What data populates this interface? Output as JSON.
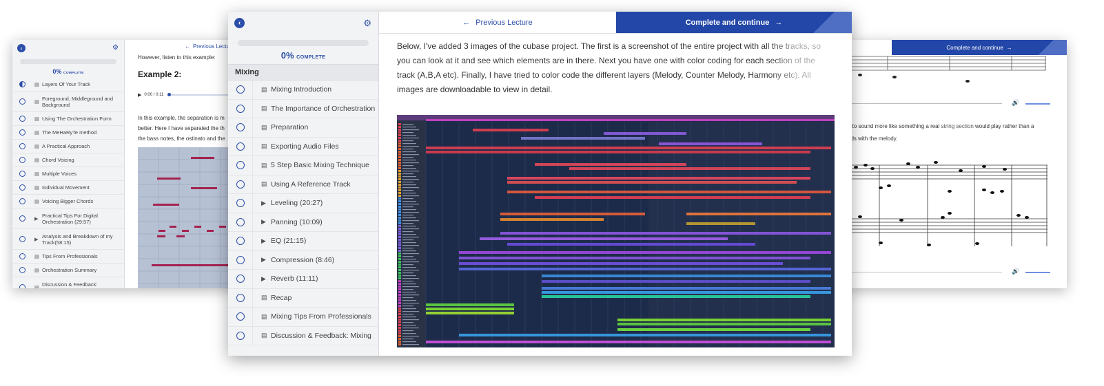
{
  "left_screen": {
    "complete_pct": "0%",
    "complete_word": "COMPLETE",
    "prev_label": "Previous Lecture",
    "intro_text": "However, listen to this example:",
    "heading": "Example 2:",
    "audio_time": "0:00 / 0:11",
    "paragraph_lines": [
      "In this example, the separation is m",
      "better. Here I have separated the th",
      "the bass notes, the ostinato and the"
    ],
    "items": [
      {
        "label": "Layers Of Your Track",
        "icon": "doc-icon",
        "state": "half"
      },
      {
        "label": "Foreground, Middleground and Background",
        "icon": "doc-icon"
      },
      {
        "label": "Using The Orchestration Form",
        "icon": "doc-icon"
      },
      {
        "label": "The MeHaRyTe method",
        "icon": "doc-icon"
      },
      {
        "label": "A Practical Approach",
        "icon": "doc-icon"
      },
      {
        "label": "Chord Voicing",
        "icon": "doc-icon"
      },
      {
        "label": "Multiple Voices",
        "icon": "doc-icon"
      },
      {
        "label": "Individual Movement",
        "icon": "doc-icon"
      },
      {
        "label": "Voicing Bigger Chords",
        "icon": "doc-icon"
      },
      {
        "label": "Practical Tips For Digital Orchestration (29:57)",
        "icon": "play-icon"
      },
      {
        "label": "Analysis and Breakdown of my Track(58:15)",
        "icon": "play-icon"
      },
      {
        "label": "Tips From Professionals",
        "icon": "doc-icon"
      },
      {
        "label": "Orchestration Summary",
        "icon": "doc-icon"
      },
      {
        "label": "Discussion & Feedback: Orchestration",
        "icon": "doc-icon"
      }
    ]
  },
  "main_screen": {
    "complete_pct": "0%",
    "complete_word": "COMPLETE",
    "section_title": "Mixing",
    "prev_label": "Previous Lecture",
    "complete_label": "Complete and continue",
    "article_lines": [
      "Below, I've added 3 images of the cubase project. The first is a screenshot of the entire project with all the tracks, so",
      "you can look at it and see which elements are in there. Next you have one with color coding for each section of the",
      "track (A,B,A etc). Finally, I have tried to color code the different layers (Melody, Counter Melody, Harmony etc). All",
      "images are downloadable to view in detail."
    ],
    "items": [
      {
        "label": "Mixing Introduction",
        "icon": "doc-icon"
      },
      {
        "label": "The Importance of Orchestration",
        "icon": "doc-icon"
      },
      {
        "label": "Preparation",
        "icon": "doc-icon"
      },
      {
        "label": "Exporting Audio Files",
        "icon": "doc-icon"
      },
      {
        "label": "5 Step Basic Mixing Technique",
        "icon": "doc-icon"
      },
      {
        "label": "Using A Reference Track",
        "icon": "doc-icon"
      },
      {
        "label": "Leveling (20:27)",
        "icon": "play-icon"
      },
      {
        "label": "Panning (10:09)",
        "icon": "play-icon"
      },
      {
        "label": "EQ (21:15)",
        "icon": "play-icon"
      },
      {
        "label": "Compression (8:46)",
        "icon": "play-icon"
      },
      {
        "label": "Reverb (11:11)",
        "icon": "play-icon"
      },
      {
        "label": "Recap",
        "icon": "doc-icon"
      },
      {
        "label": "Mixing Tips From Professionals",
        "icon": "doc-icon"
      },
      {
        "label": "Discussion & Feedback: Mixing",
        "icon": "doc-icon"
      }
    ]
  },
  "right_screen": {
    "complete_label": "Complete and continue",
    "text_line1_a": "g to sound more like something a real ",
    "text_line1_b": "string section",
    "text_line1_c": " would play rather than a",
    "text_line2": "nds with the melody."
  },
  "colors": {
    "accent": "#2b4ea8",
    "complete_button": "#2347a8",
    "daw_background": "#1c2a48"
  }
}
